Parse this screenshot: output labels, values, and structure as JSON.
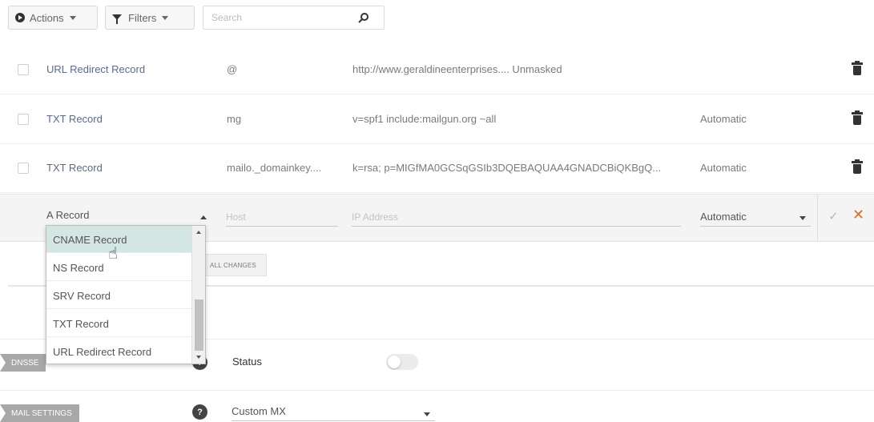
{
  "toolbar": {
    "actions_label": "Actions",
    "filters_label": "Filters",
    "search_placeholder": "Search"
  },
  "records": [
    {
      "type": "URL Redirect Record",
      "host": "@",
      "value": "http://www.geraldineenterprises....   Unmasked",
      "ttl": ""
    },
    {
      "type": "TXT Record",
      "host": "mg",
      "value": "v=spf1 include:mailgun.org ~all",
      "ttl": "Automatic"
    },
    {
      "type": "TXT Record",
      "host": "mailo._domainkey....",
      "value": "k=rsa; p=MIGfMA0GCSqGSIb3DQEBAQUAA4GNADCBiQKBgQ...",
      "ttl": "Automatic"
    }
  ],
  "edit_row": {
    "type_value": "A Record",
    "host_placeholder": "Host",
    "ip_placeholder": "IP Address",
    "ttl_value": "Automatic"
  },
  "dropdown": {
    "options": [
      "CNAME Record",
      "NS Record",
      "SRV Record",
      "TXT Record",
      "URL Redirect Record"
    ],
    "highlighted": "CNAME Record"
  },
  "save_all_label": "ALL CHANGES",
  "settings": {
    "dnssec_tag": "DNSSE",
    "status_label": "Status",
    "mail_tag": "MAIL SETTINGS",
    "mail_value": "Custom MX"
  },
  "colors": {
    "accent_teal": "#d4e6e4",
    "cancel_orange": "#e26b1f",
    "ok_green": "#9fc7a8"
  }
}
